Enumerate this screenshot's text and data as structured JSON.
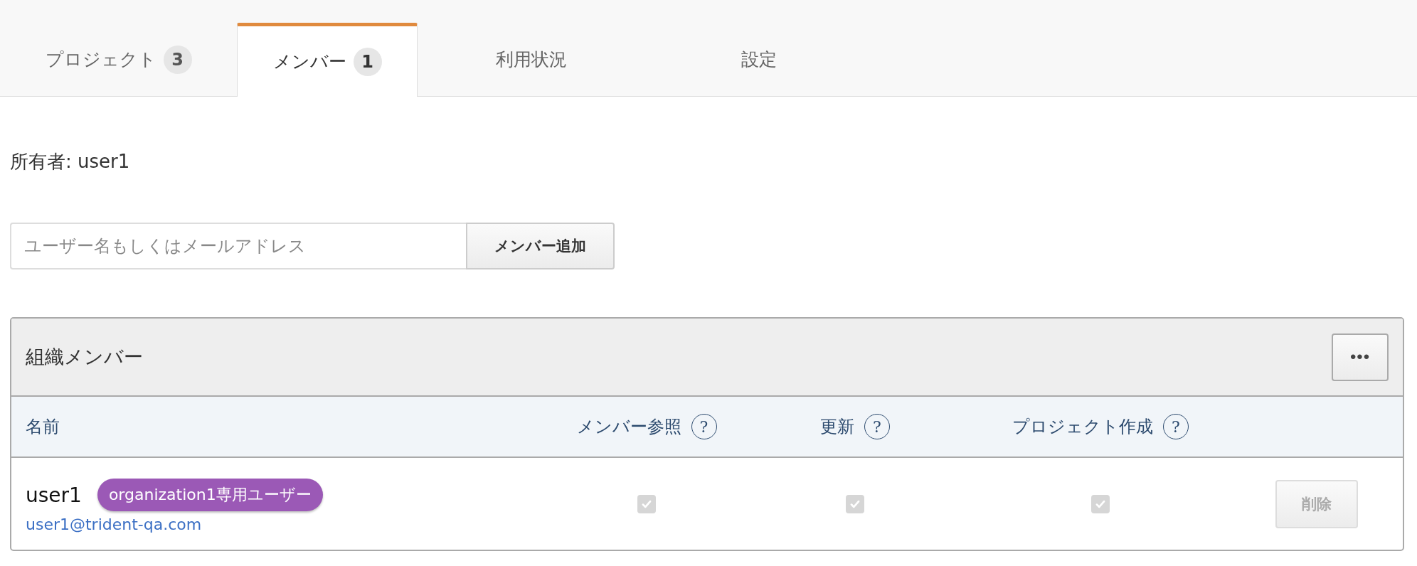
{
  "tabs": [
    {
      "label": "プロジェクト",
      "badge": "3",
      "selected": false
    },
    {
      "label": "メンバー",
      "badge": "1",
      "selected": true
    },
    {
      "label": "利用状況",
      "selected": false
    },
    {
      "label": "設定",
      "selected": false
    }
  ],
  "owner": "所有者: user1",
  "add_member": {
    "placeholder": "ユーザー名もしくはメールアドレス",
    "button": "メンバー追加"
  },
  "panel": {
    "title": "組織メンバー",
    "menu_button": "•••",
    "columns": [
      {
        "label": "名前"
      },
      {
        "label": "メンバー参照",
        "help": "?"
      },
      {
        "label": "更新",
        "help": "?"
      },
      {
        "label": "プロジェクト作成",
        "help": "?"
      }
    ],
    "rows": [
      {
        "name": "user1",
        "tag": "organization1専用ユーザー",
        "email": "user1@trident-qa.com",
        "permissions": [
          {
            "checked": true,
            "disabled": true
          },
          {
            "checked": true,
            "disabled": true
          },
          {
            "checked": true,
            "disabled": true
          }
        ],
        "delete": {
          "label": "削除",
          "disabled": true
        }
      }
    ]
  }
}
